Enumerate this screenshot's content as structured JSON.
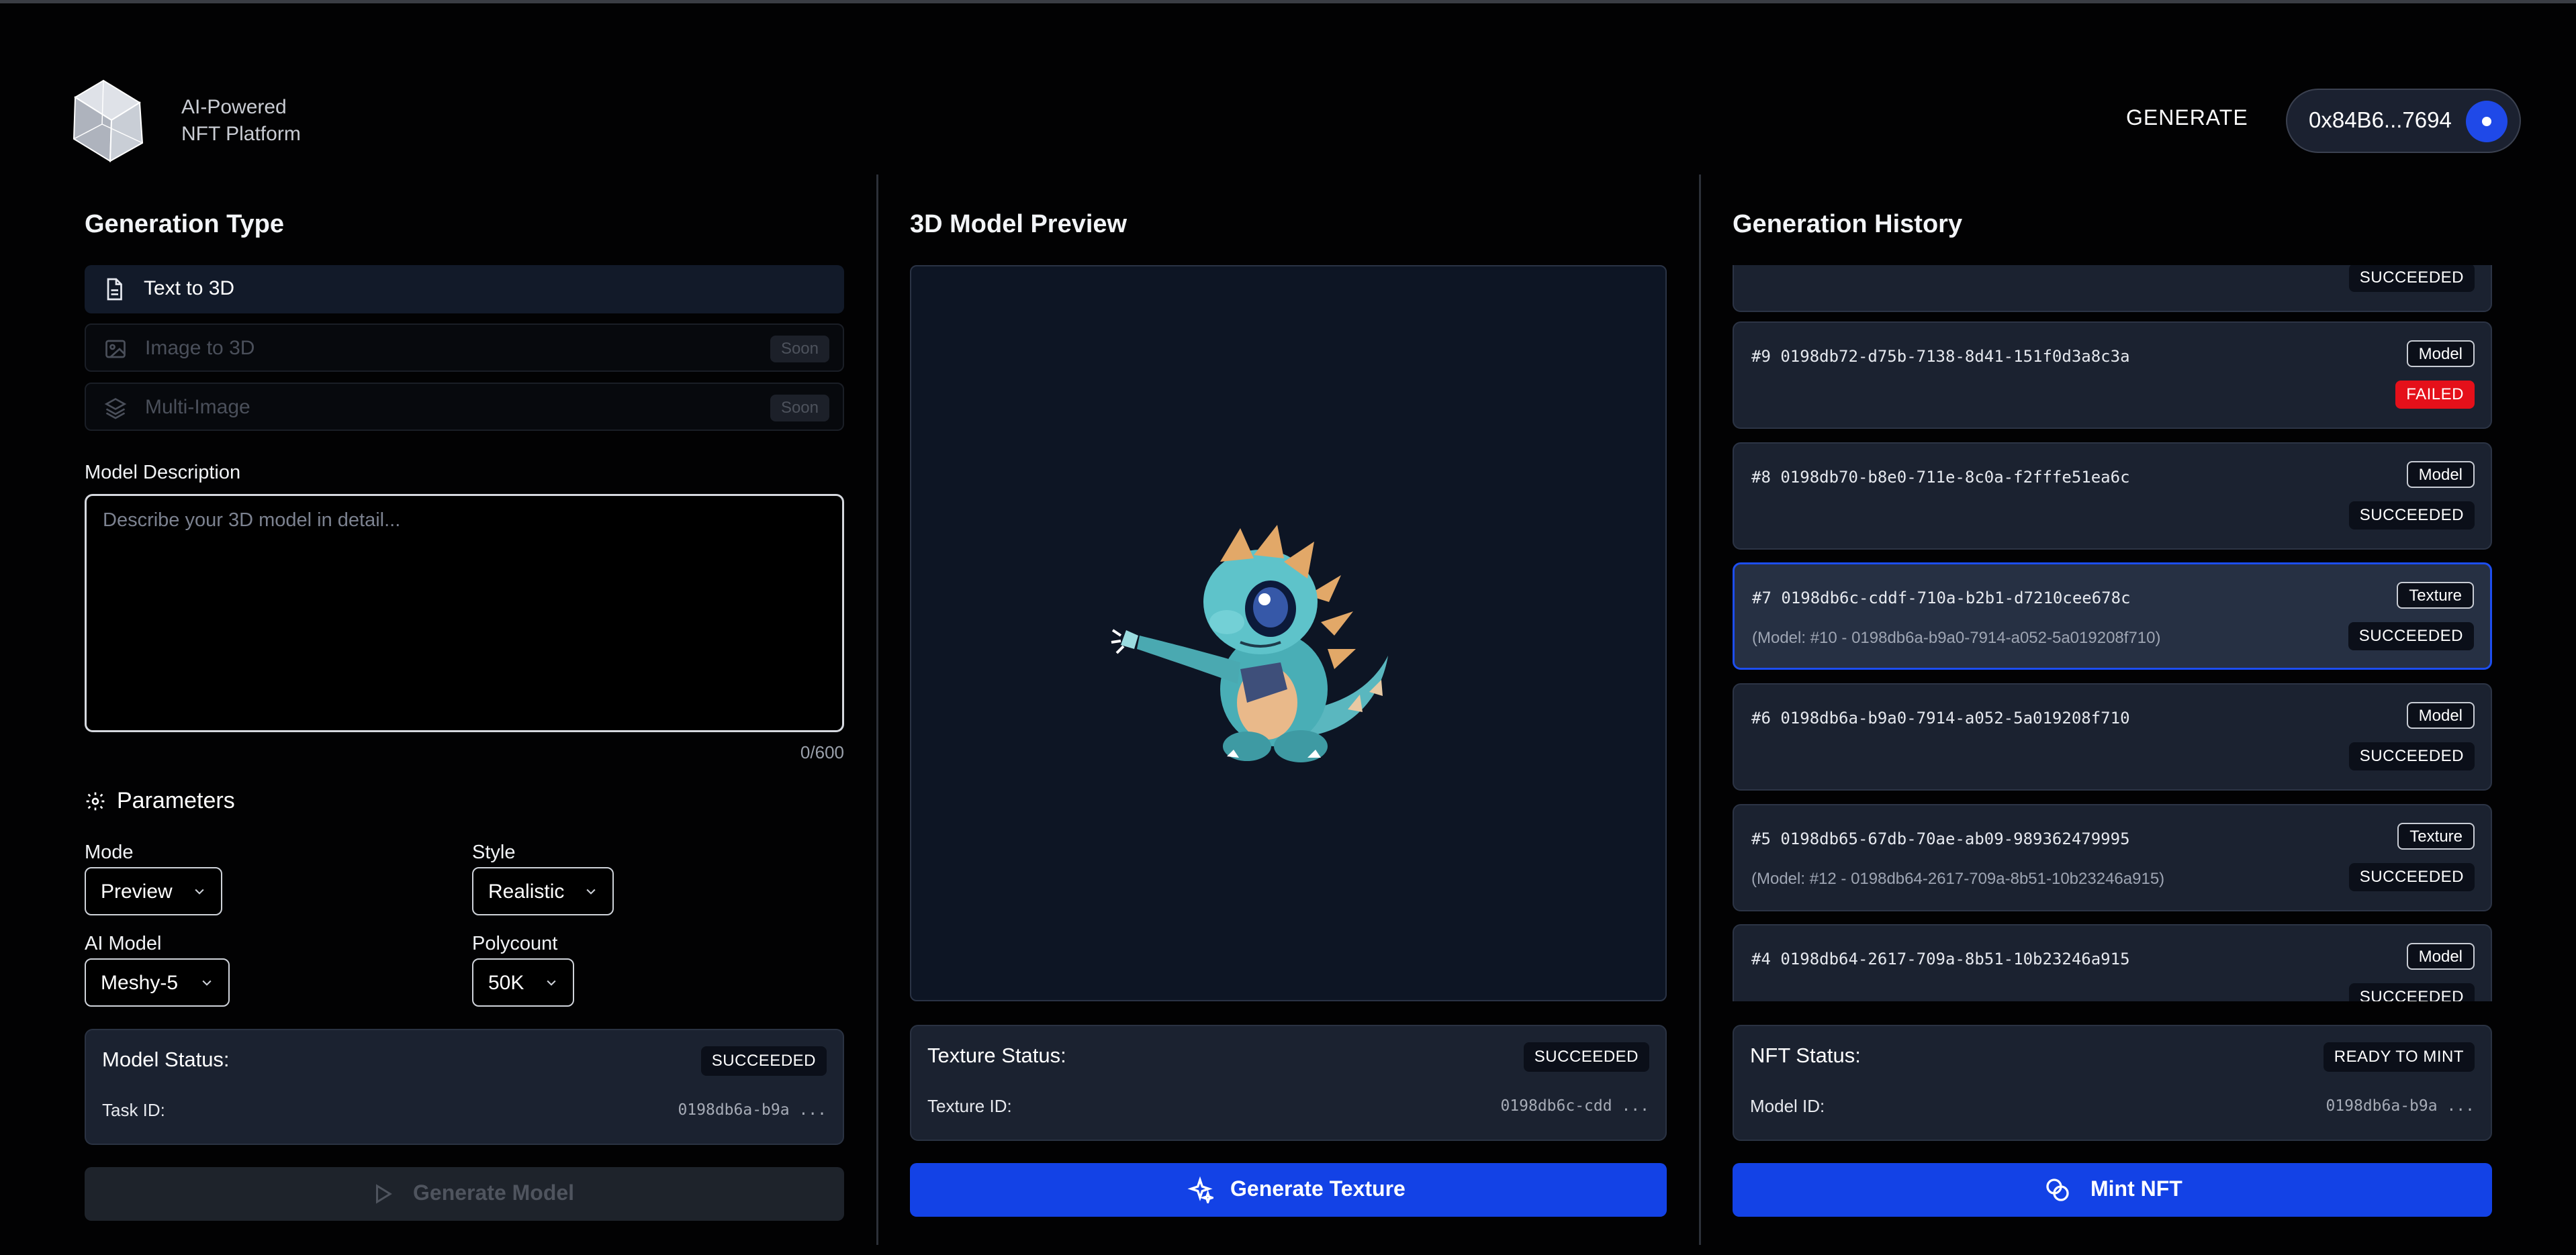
{
  "header": {
    "brand_line1": "AI-Powered",
    "brand_line2": "NFT Platform",
    "nav_generate": "GENERATE",
    "wallet_address": "0x84B6...7694"
  },
  "generation": {
    "title": "Generation Type",
    "options": [
      {
        "label": "Text to 3D",
        "icon": "document-icon",
        "badge": ""
      },
      {
        "label": "Image to 3D",
        "icon": "image-icon",
        "badge": "Soon"
      },
      {
        "label": "Multi-Image",
        "icon": "layers-icon",
        "badge": "Soon"
      }
    ],
    "description_label": "Model Description",
    "description_placeholder": "Describe your 3D model in detail...",
    "char_count": "0/600"
  },
  "parameters": {
    "title": "Parameters",
    "mode_label": "Mode",
    "mode_value": "Preview",
    "style_label": "Style",
    "style_value": "Realistic",
    "ai_model_label": "AI Model",
    "ai_model_value": "Meshy-5",
    "polycount_label": "Polycount",
    "polycount_value": "50K"
  },
  "model_status": {
    "title": "Model Status:",
    "badge": "SUCCEEDED",
    "key": "Task ID:",
    "value": "0198db6a-b9a ..."
  },
  "generate_model_button": "Generate Model",
  "preview": {
    "title": "3D Model Preview"
  },
  "texture_status": {
    "title": "Texture Status:",
    "badge": "SUCCEEDED",
    "key": "Texture ID:",
    "value": "0198db6c-cdd ..."
  },
  "generate_texture_button": "Generate Texture",
  "history": {
    "title": "Generation History",
    "partial_top_status": "SUCCEEDED",
    "items": [
      {
        "id": "#9 0198db72-d75b-7138-8d41-151f0d3a8c3a",
        "type": "Model",
        "status": "FAILED",
        "sub": ""
      },
      {
        "id": "#8 0198db70-b8e0-711e-8c0a-f2fffe51ea6c",
        "type": "Model",
        "status": "SUCCEEDED",
        "sub": ""
      },
      {
        "id": "#7 0198db6c-cddf-710a-b2b1-d7210cee678c",
        "type": "Texture",
        "status": "SUCCEEDED",
        "sub": "(Model: #10 - 0198db6a-b9a0-7914-a052-5a019208f710)"
      },
      {
        "id": "#6 0198db6a-b9a0-7914-a052-5a019208f710",
        "type": "Model",
        "status": "SUCCEEDED",
        "sub": ""
      },
      {
        "id": "#5 0198db65-67db-70ae-ab09-989362479995",
        "type": "Texture",
        "status": "SUCCEEDED",
        "sub": "(Model: #12 - 0198db64-2617-709a-8b51-10b23246a915)"
      },
      {
        "id": "#4 0198db64-2617-709a-8b51-10b23246a915",
        "type": "Model",
        "status": "SUCCEEDED",
        "sub": ""
      }
    ]
  },
  "nft_status": {
    "title": "NFT Status:",
    "badge": "READY TO MINT",
    "key": "Model ID:",
    "value": "0198db6a-b9a ..."
  },
  "mint_button": "Mint NFT",
  "colors": {
    "accent": "#1342e6",
    "failed": "#e5101a",
    "card": "#1b2230"
  }
}
